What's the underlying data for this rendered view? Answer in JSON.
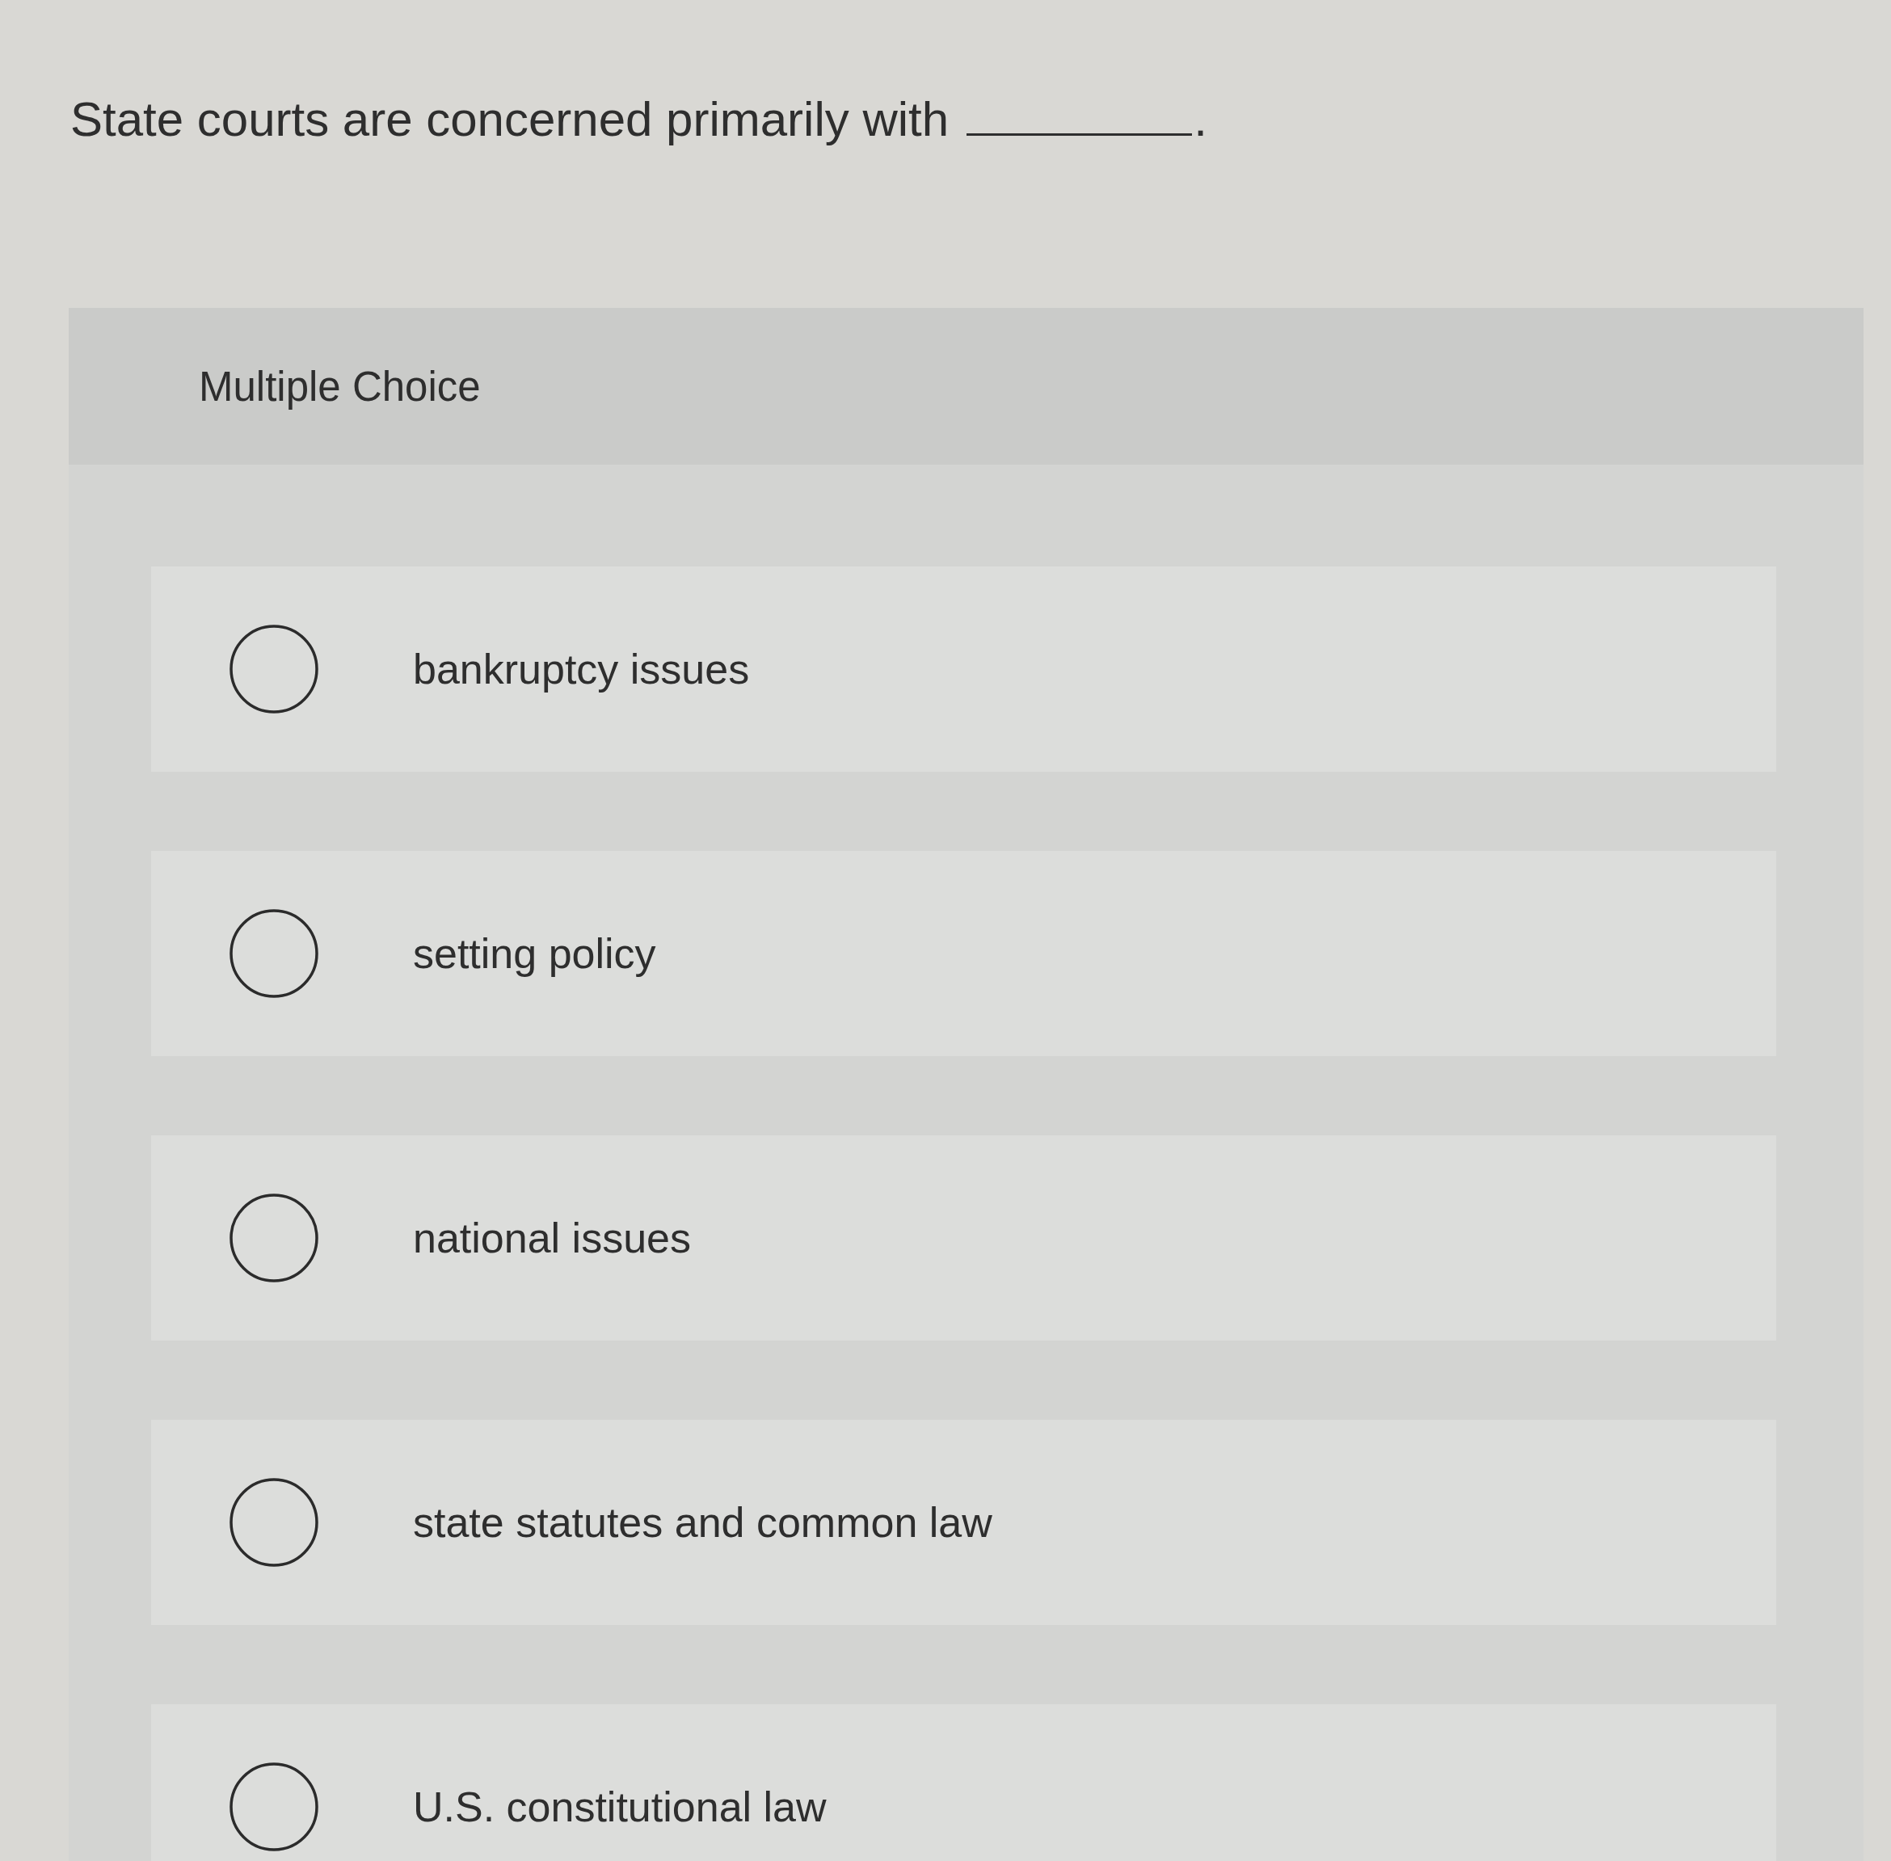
{
  "question": {
    "text_before_blank": "State courts are concerned primarily with",
    "text_after_blank": "."
  },
  "panel": {
    "heading": "Multiple Choice"
  },
  "options": [
    {
      "label": "bankruptcy issues",
      "selected": false
    },
    {
      "label": "setting policy",
      "selected": false
    },
    {
      "label": "national issues",
      "selected": false
    },
    {
      "label": "state statutes and common law",
      "selected": false
    },
    {
      "label": "U.S. constitutional law",
      "selected": false
    }
  ]
}
